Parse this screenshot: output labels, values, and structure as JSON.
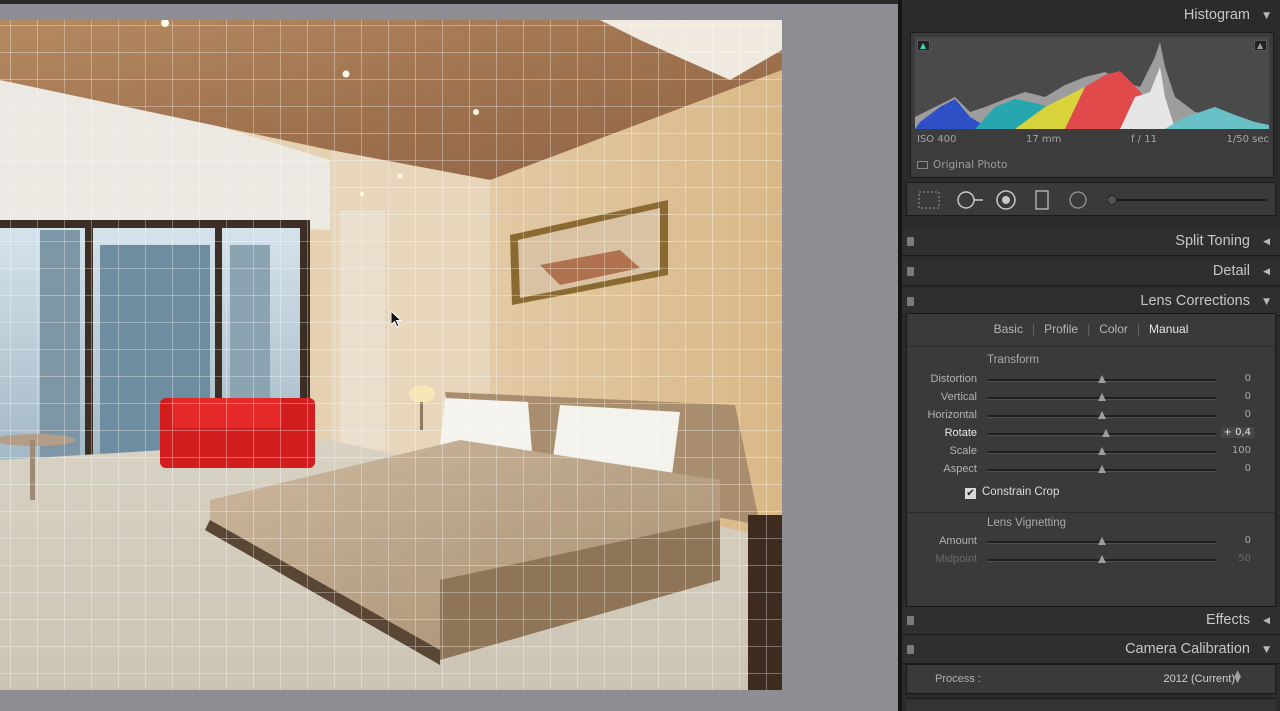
{
  "histogram": {
    "title": "Histogram",
    "iso": "ISO 400",
    "focal_length": "17 mm",
    "aperture": "f / 11",
    "shutter": "1/50 sec",
    "original_photo_label": "Original Photo"
  },
  "sections": {
    "split_toning": "Split Toning",
    "detail": "Detail",
    "lens_corrections": "Lens Corrections",
    "effects": "Effects",
    "camera_calibration": "Camera Calibration"
  },
  "lens_tabs": [
    "Basic",
    "Profile",
    "Color",
    "Manual"
  ],
  "lens_active_tab": "Manual",
  "transform": {
    "title": "Transform",
    "sliders": [
      {
        "label": "Distortion",
        "value": "0",
        "fraction": 0.5
      },
      {
        "label": "Vertical",
        "value": "0",
        "fraction": 0.5
      },
      {
        "label": "Horizontal",
        "value": "0",
        "fraction": 0.5
      },
      {
        "label": "Rotate",
        "value": "+ 0,4",
        "fraction": 0.52
      },
      {
        "label": "Scale",
        "value": "100",
        "fraction": 0.5
      },
      {
        "label": "Aspect",
        "value": "0",
        "fraction": 0.5
      }
    ],
    "constrain_crop_label": "Constrain Crop",
    "constrain_crop_checked": true
  },
  "vignetting": {
    "title": "Lens Vignetting",
    "sliders": [
      {
        "label": "Amount",
        "value": "0",
        "fraction": 0.5
      },
      {
        "label": "Midpoint",
        "value": "50",
        "fraction": 0.5
      }
    ]
  },
  "process": {
    "label": "Process :",
    "value": "2012 (Current)"
  },
  "colors": {
    "viewer_bg": "#8e8d93",
    "panel_bg": "#2b2b2b",
    "accent_text": "#e6e6e6"
  }
}
